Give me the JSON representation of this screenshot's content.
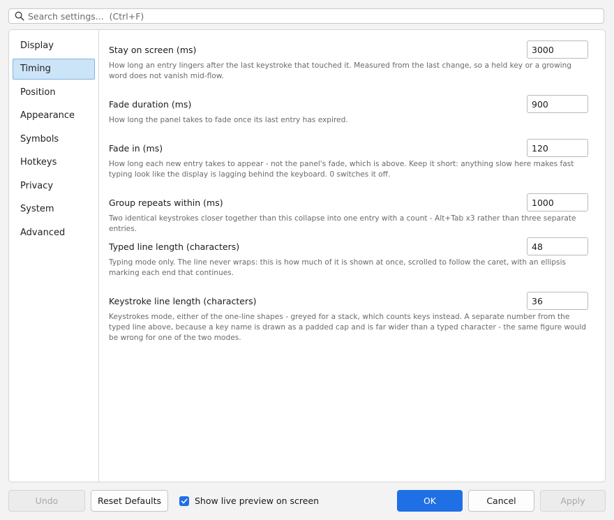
{
  "search": {
    "placeholder": "Search settings...  (Ctrl+F)"
  },
  "sidebar": {
    "items": [
      {
        "label": "Display"
      },
      {
        "label": "Timing",
        "selected": true
      },
      {
        "label": "Position"
      },
      {
        "label": "Appearance"
      },
      {
        "label": "Symbols"
      },
      {
        "label": "Hotkeys"
      },
      {
        "label": "Privacy"
      },
      {
        "label": "System"
      },
      {
        "label": "Advanced"
      }
    ]
  },
  "settings": [
    {
      "title": "Stay on screen (ms)",
      "value": "3000",
      "description": "How long an entry lingers after the last keystroke that touched it. Measured from the last change, so a held key or a growing word does not vanish mid-flow."
    },
    {
      "title": "Fade duration (ms)",
      "value": "900",
      "description": "How long the panel takes to fade once its last entry has expired."
    },
    {
      "title": "Fade in (ms)",
      "value": "120",
      "description": "How long each new entry takes to appear - not the panel's fade, which is above. Keep it short: anything slow here makes fast typing look like the display is lagging behind the keyboard. 0 switches it off."
    },
    {
      "title": "Group repeats within (ms)",
      "value": "1000",
      "description": "Two identical keystrokes closer together than this collapse into one entry with a count - Alt+Tab x3 rather than three separate entries."
    },
    {
      "title": "Typed line length (characters)",
      "value": "48",
      "description": "Typing mode only. The line never wraps: this is how much of it is shown at once, scrolled to follow the caret, with an ellipsis marking each end that continues."
    },
    {
      "title": "Keystroke line length (characters)",
      "value": "36",
      "description": "Keystrokes mode, either of the one-line shapes - greyed for a stack, which counts keys instead. A separate number from the typed line above, because a key name is drawn as a padded cap and is far wider than a typed character - the same figure would be wrong for one of the two modes."
    }
  ],
  "footer": {
    "undo": "Undo",
    "reset": "Reset Defaults",
    "preview_label": "Show live preview on screen",
    "preview_checked": true,
    "ok": "OK",
    "cancel": "Cancel",
    "apply": "Apply"
  },
  "colors": {
    "accent": "#1f6fe5",
    "selected_bg": "#cce4f7",
    "selected_border": "#7fb3e0"
  }
}
